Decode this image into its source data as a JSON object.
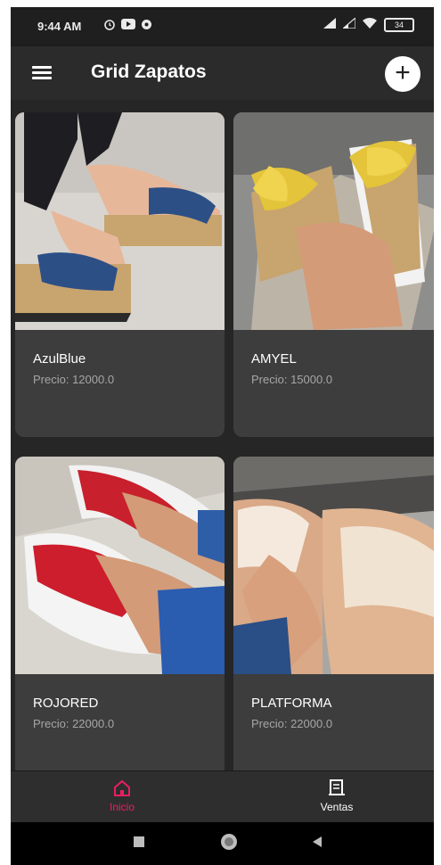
{
  "status_bar": {
    "time": "9:44 AM",
    "left_icons": [
      "alarm-icon",
      "youtube-icon",
      "settings-icon"
    ],
    "right_icons": [
      "signal-icon",
      "signal-2-icon",
      "wifi-icon",
      "battery-icon"
    ],
    "battery_level": "34"
  },
  "app_bar": {
    "title": "Grid Zapatos",
    "menu_icon": "hamburger-menu-icon",
    "add_icon": "plus-icon",
    "add_label": "+"
  },
  "products": [
    {
      "name": "AzulBlue",
      "price": "Precio: 12000.0",
      "image": "blue-wedge-sandal-photo"
    },
    {
      "name": "AMYEL",
      "price": "Precio: 15000.0",
      "image": "yellow-bow-slide-photo"
    },
    {
      "name": "ROJORED",
      "price": "Precio: 22000.0",
      "image": "red-sport-sandal-photo"
    },
    {
      "name": "PLATFORMA",
      "price": "Precio: 22000.0",
      "image": "beige-platform-slide-photo"
    }
  ],
  "bottom_nav": {
    "items": [
      {
        "label": "Inicio",
        "icon": "home-icon",
        "active": true,
        "color": "#e91e63"
      },
      {
        "label": "Ventas",
        "icon": "receipt-icon",
        "active": false,
        "color": "#ffffff"
      }
    ]
  },
  "system_nav": {
    "buttons": [
      "recents-square-icon",
      "home-circle-icon",
      "back-triangle-icon"
    ]
  },
  "colors": {
    "background": "#2a2a2a",
    "card": "#3d3d3d",
    "accent": "#e91e63",
    "text_primary": "#ffffff",
    "text_secondary": "#a6a6a6"
  }
}
